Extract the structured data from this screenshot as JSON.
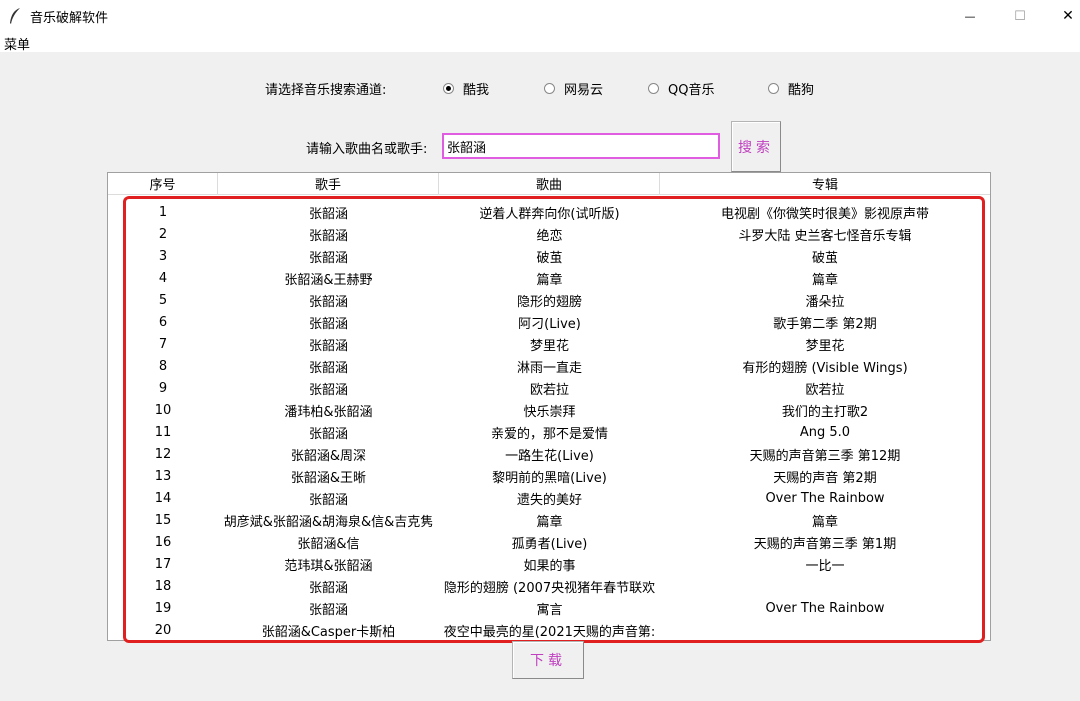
{
  "window": {
    "title": "音乐破解软件",
    "minimize_glyph": "—",
    "maximize_glyph": "☐",
    "close_glyph": "✕"
  },
  "menu": {
    "label": "菜单"
  },
  "channel": {
    "label": "请选择音乐搜索通道:",
    "options": [
      "酷我",
      "网易云",
      "QQ音乐",
      "酷狗"
    ],
    "selected": "酷我"
  },
  "search": {
    "label": "请输入歌曲名或歌手:",
    "value": "张韶涵",
    "button_label": "搜索"
  },
  "table": {
    "columns": [
      "序号",
      "歌手",
      "歌曲",
      "专辑"
    ],
    "rows": [
      [
        "1",
        "张韶涵",
        "逆着人群奔向你(试听版)",
        "电视剧《你微笑时很美》影视原声带"
      ],
      [
        "2",
        "张韶涵",
        "绝恋",
        "斗罗大陆 史兰客七怪音乐专辑"
      ],
      [
        "3",
        "张韶涵",
        "破茧",
        "破茧"
      ],
      [
        "4",
        "张韶涵&王赫野",
        "篇章",
        "篇章"
      ],
      [
        "5",
        "张韶涵",
        "隐形的翅膀",
        "潘朵拉"
      ],
      [
        "6",
        "张韶涵",
        "阿刁(Live)",
        "歌手第二季 第2期"
      ],
      [
        "7",
        "张韶涵",
        "梦里花",
        "梦里花"
      ],
      [
        "8",
        "张韶涵",
        "淋雨一直走",
        "有形的翅膀 (Visible Wings)"
      ],
      [
        "9",
        "张韶涵",
        "欧若拉",
        "欧若拉"
      ],
      [
        "10",
        "潘玮柏&张韶涵",
        "快乐崇拜",
        "我们的主打歌2"
      ],
      [
        "11",
        "张韶涵",
        "亲爱的，那不是爱情",
        "Ang 5.0"
      ],
      [
        "12",
        "张韶涵&周深",
        "一路生花(Live)",
        "天赐的声音第三季 第12期"
      ],
      [
        "13",
        "张韶涵&王晰",
        "黎明前的黑暗(Live)",
        "天赐的声音 第2期"
      ],
      [
        "14",
        "张韶涵",
        "遗失的美好",
        "Over The Rainbow"
      ],
      [
        "15",
        "胡彦斌&张韶涵&胡海泉&信&吉克隽",
        "篇章",
        "篇章"
      ],
      [
        "16",
        "张韶涵&信",
        "孤勇者(Live)",
        "天赐的声音第三季 第1期"
      ],
      [
        "17",
        "范玮琪&张韶涵",
        "如果的事",
        "一比一"
      ],
      [
        "18",
        "张韶涵",
        "隐形的翅膀 (2007央视猪年春节联欢",
        ""
      ],
      [
        "19",
        "张韶涵",
        "寓言",
        "Over The Rainbow"
      ],
      [
        "20",
        "张韶涵&Casper卡斯柏",
        "夜空中最亮的星(2021天赐的声音第:",
        ""
      ]
    ]
  },
  "download": {
    "button_label": "下载"
  },
  "colors": {
    "accent": "#c040c0",
    "input_border": "#e05ce0",
    "highlight": "#e02020"
  }
}
